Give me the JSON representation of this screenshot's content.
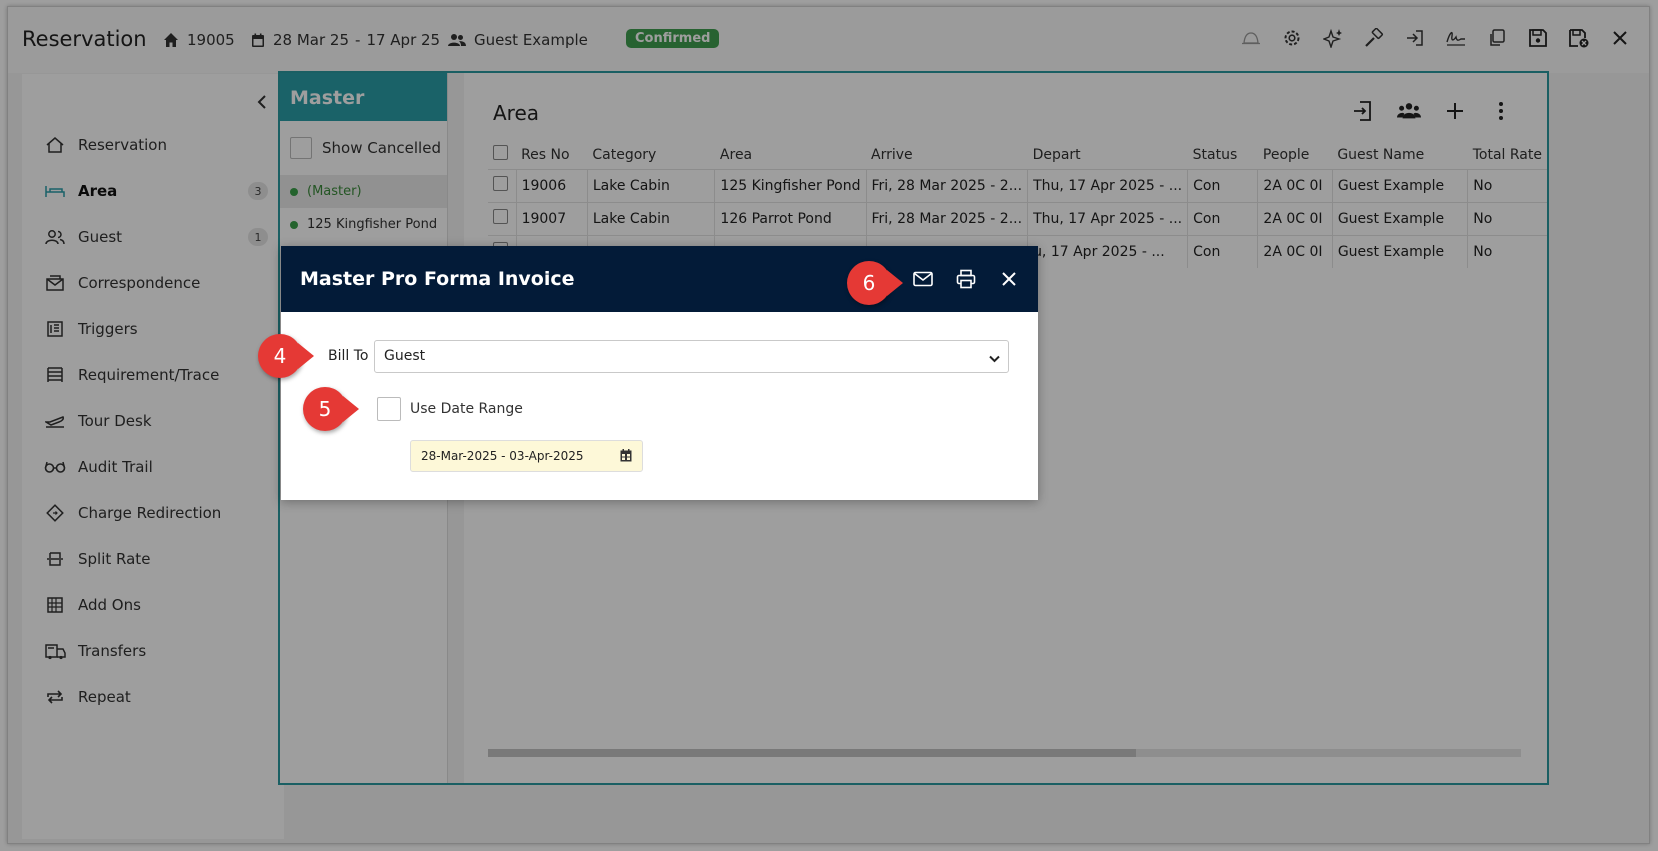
{
  "header": {
    "title": "Reservation",
    "res_no": "19005",
    "dates": "28 Mar 25",
    "dates_sep": "-",
    "dates_end": "17 Apr 25",
    "guest": "Guest Example",
    "status_badge": "Confirmed",
    "toolbar_icons": [
      "bell-icon",
      "gear-icon",
      "sparkle-icon",
      "hammer-icon",
      "sign-in-icon",
      "signature-icon",
      "copy-icon",
      "save-icon",
      "save-close-icon",
      "close-icon"
    ]
  },
  "sidebar": {
    "items": [
      {
        "label": "Reservation",
        "icon": "home-icon"
      },
      {
        "label": "Area",
        "icon": "bed-icon",
        "count": "3",
        "active": true
      },
      {
        "label": "Guest",
        "icon": "users-icon",
        "count": "1"
      },
      {
        "label": "Correspondence",
        "icon": "mail-icon"
      },
      {
        "label": "Triggers",
        "icon": "triggers-icon"
      },
      {
        "label": "Requirement/Trace",
        "icon": "list-icon"
      },
      {
        "label": "Tour Desk",
        "icon": "plane-icon"
      },
      {
        "label": "Audit Trail",
        "icon": "glasses-icon"
      },
      {
        "label": "Charge Redirection",
        "icon": "diamond-icon"
      },
      {
        "label": "Split Rate",
        "icon": "split-icon"
      },
      {
        "label": "Add Ons",
        "icon": "abacus-icon"
      },
      {
        "label": "Transfers",
        "icon": "transfer-icon"
      },
      {
        "label": "Repeat",
        "icon": "repeat-icon"
      }
    ]
  },
  "master": {
    "header": "Master",
    "show_cancelled": "Show Cancelled",
    "items": [
      "(Master)",
      "125 Kingfisher Pond"
    ]
  },
  "area": {
    "title": "Area",
    "columns": [
      "Res No",
      "Category",
      "Area",
      "Arrive",
      "Depart",
      "Status",
      "People",
      "Guest Name",
      "Total Rate"
    ],
    "rows": [
      [
        "19006",
        "Lake Cabin",
        "125 Kingfisher Pond",
        "Fri, 28 Mar 2025 - 2...",
        "Thu, 17 Apr 2025 - ...",
        "Con",
        "2A 0C 0I",
        "Guest Example",
        "No"
      ],
      [
        "19007",
        "Lake Cabin",
        "126 Parrot Pond",
        "Fri, 28 Mar 2025 - 2...",
        "Thu, 17 Apr 2025 - ...",
        "Con",
        "2A 0C 0I",
        "Guest Example",
        "No"
      ],
      [
        "",
        "",
        "",
        "",
        "u, 17 Apr 2025 - ...",
        "Con",
        "2A 0C 0I",
        "Guest Example",
        "No"
      ]
    ]
  },
  "modal": {
    "title": "Master Pro Forma Invoice",
    "bill_to_label": "Bill To",
    "bill_to_value": "Guest",
    "use_date_range": "Use Date Range",
    "date_range": "28-Mar-2025 - 03-Apr-2025"
  },
  "callouts": [
    "4",
    "5",
    "6"
  ],
  "colors": {
    "accent": "#2b9ea8",
    "modal_header": "#031b38",
    "badge": "#3f9e4f",
    "callout": "#e53935",
    "date_bg": "#fdf8d8"
  }
}
